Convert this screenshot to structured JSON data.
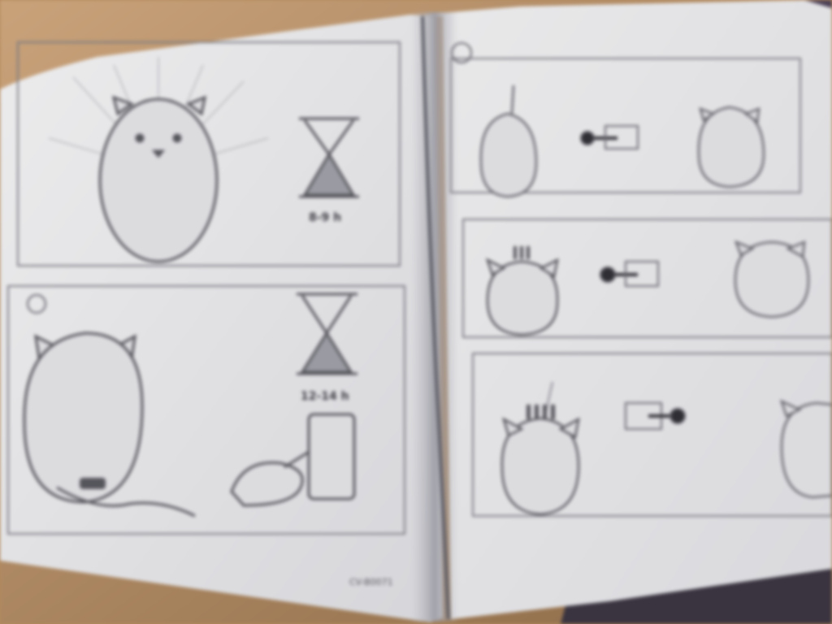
{
  "photo": {
    "kind": "photograph of an unfolded instruction leaflet",
    "colors": {
      "table": "#b58a5e",
      "paper": "#e4e4e6",
      "paper_shadow": "#cfcfd3",
      "ink": "#4a4a50",
      "dark_right_edge": "#3a3440"
    }
  },
  "panels": [
    {
      "step_marker": "",
      "step_time": "8-9 h"
    },
    {
      "step_marker": "",
      "step_time": "12-14 h"
    },
    {
      "step_marker": ""
    },
    {
      "step_marker": ""
    },
    {
      "step_marker": ""
    }
  ],
  "footer_text": "CV-B0071"
}
